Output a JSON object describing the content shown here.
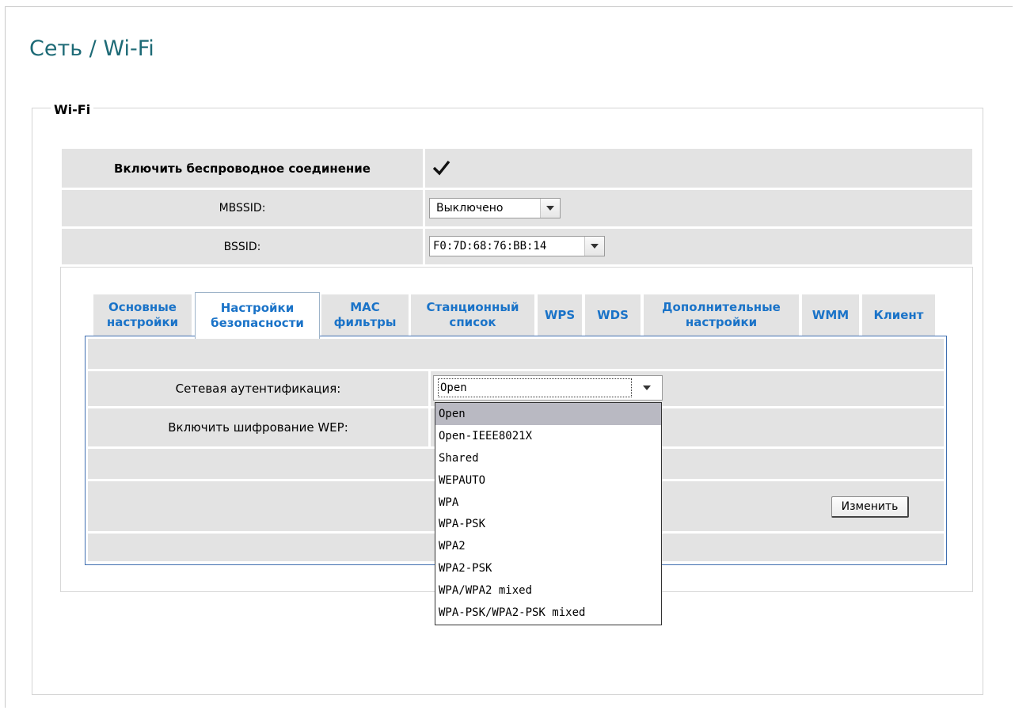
{
  "page": {
    "title": "Сеть / Wi-Fi"
  },
  "wifi": {
    "legend": "Wi-Fi",
    "enable_label": "Включить беспроводное соединение",
    "enable_checked": true,
    "mbssid_label": "MBSSID:",
    "mbssid_value": "Выключено",
    "bssid_label": "BSSID:",
    "bssid_value": "F0:7D:68:76:BB:14"
  },
  "tabs": [
    {
      "line1": "Основные",
      "line2": "настройки",
      "active": false
    },
    {
      "line1": "Настройки",
      "line2": "безопасности",
      "active": true
    },
    {
      "line1": "MAC",
      "line2": "фильтры",
      "active": false
    },
    {
      "line1": "Станционный",
      "line2": "список",
      "active": false
    },
    {
      "line1": "WPS",
      "line2": "",
      "active": false
    },
    {
      "line1": "WDS",
      "line2": "",
      "active": false
    },
    {
      "line1": "Дополнительные",
      "line2": "настройки",
      "active": false
    },
    {
      "line1": "WMM",
      "line2": "",
      "active": false
    },
    {
      "line1": "Клиент",
      "line2": "",
      "active": false
    }
  ],
  "security": {
    "auth_label": "Сетевая аутентификация:",
    "auth_value": "Open",
    "wep_label": "Включить шифрование WEP:",
    "change_button": "Изменить",
    "auth_options": [
      "Open",
      "Open-IEEE8021X",
      "Shared",
      "WEPAUTO",
      "WPA",
      "WPA-PSK",
      "WPA2",
      "WPA2-PSK",
      "WPA/WPA2 mixed",
      "WPA-PSK/WPA2-PSK mixed"
    ],
    "auth_selected_index": 0
  },
  "colors": {
    "title": "#1d6a76",
    "tab_text": "#1a73c8",
    "row_bg": "#e3e3e3",
    "panel_border": "#3f6fb0",
    "dropdown_highlight": "#b9b9c2"
  }
}
